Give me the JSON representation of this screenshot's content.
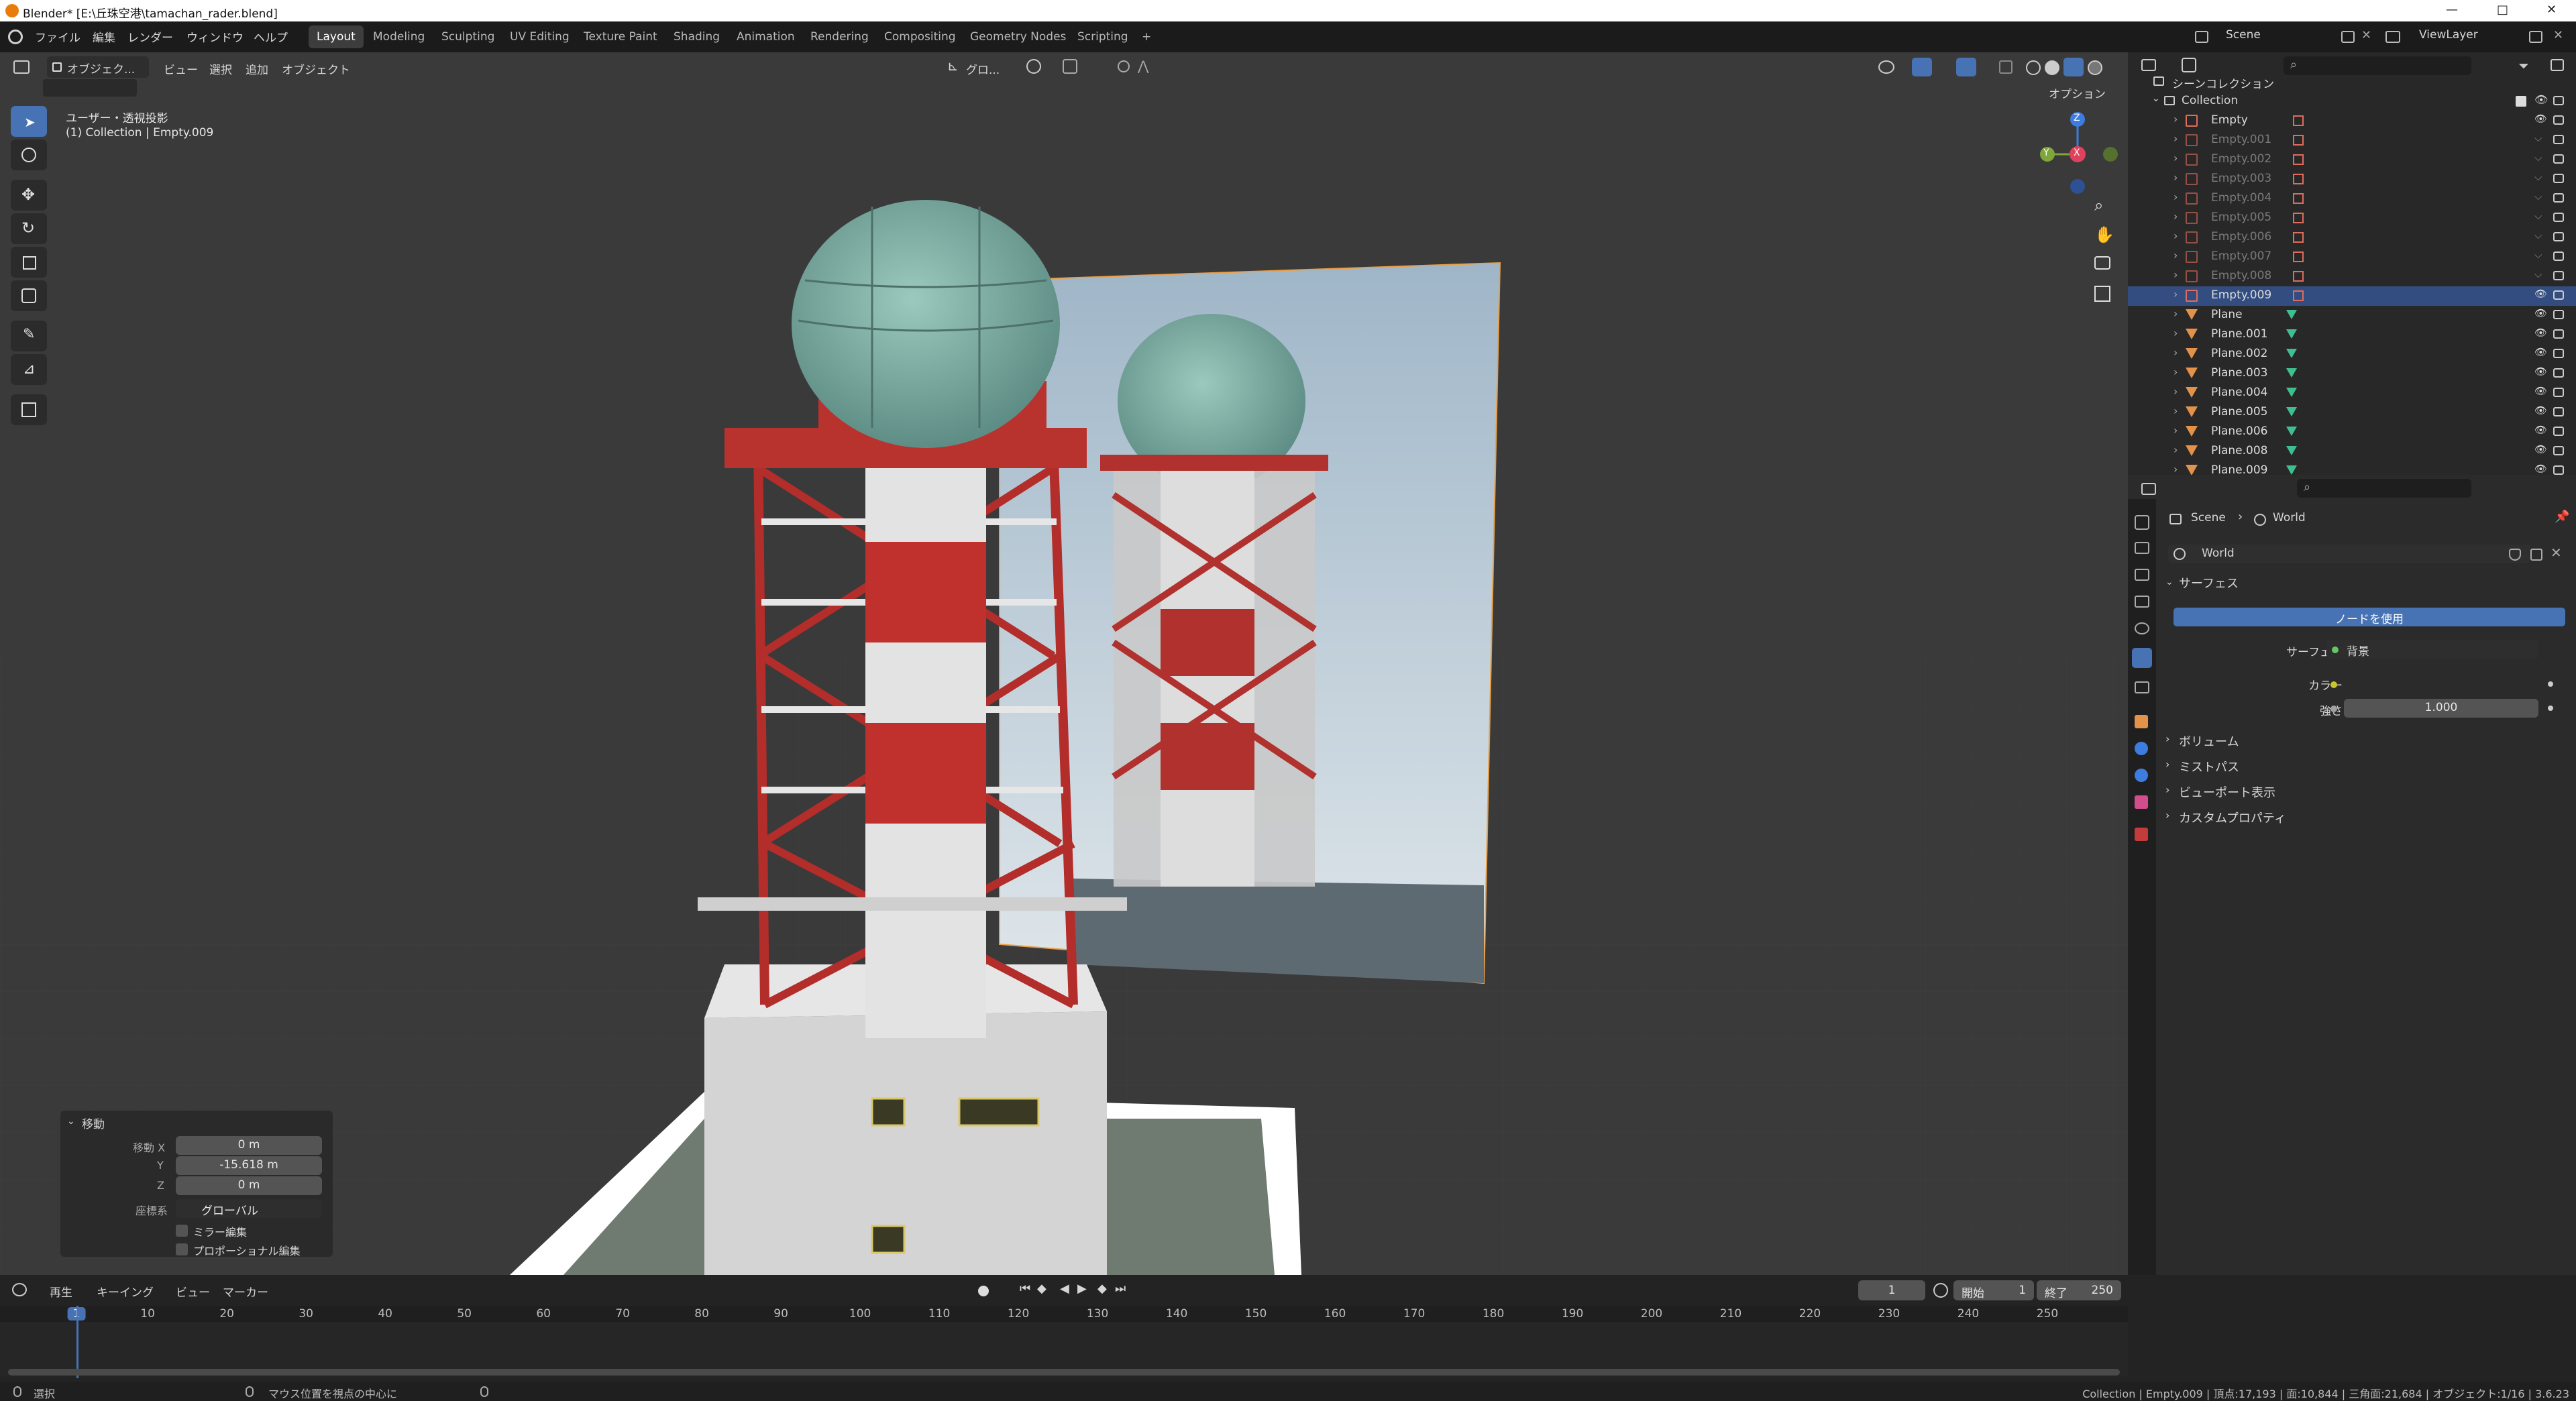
{
  "window": {
    "title": "Blender* [E:\\丘珠空港\\tamachan_rader.blend]",
    "minimize": "—",
    "maximize": "□",
    "close": "✕"
  },
  "menu": {
    "items": [
      "ファイル",
      "編集",
      "レンダー",
      "ウィンドウ",
      "ヘルプ"
    ]
  },
  "workspaces": {
    "tabs": [
      "Layout",
      "Modeling",
      "Sculpting",
      "UV Editing",
      "Texture Paint",
      "Shading",
      "Animation",
      "Rendering",
      "Compositing",
      "Geometry Nodes",
      "Scripting"
    ],
    "active": "Layout",
    "add": "+"
  },
  "topright": {
    "scene": "Scene",
    "viewlayer": "ViewLayer"
  },
  "viewport": {
    "mode": "オブジェク...",
    "menu": [
      "ビュー",
      "選択",
      "追加",
      "オブジェクト"
    ],
    "transform_orientation": "グロ...",
    "options": "オプション",
    "view_name": "ユーザー・透視投影",
    "context": "(1) Collection | Empty.009",
    "axis_x": "X",
    "axis_y": "Y",
    "axis_z": "Z"
  },
  "redo_panel": {
    "title": "移動",
    "move_x_label": "移動 X",
    "move_x": "0 m",
    "y_label": "Y",
    "y": "-15.618 m",
    "z_label": "Z",
    "z": "0 m",
    "orientation_label": "座標系",
    "orientation": "グローバル",
    "mirror": "ミラー編集",
    "proportional": "プロポーショナル編集"
  },
  "outliner": {
    "scene_collection": "シーンコレクション",
    "collection": "Collection",
    "objects": [
      {
        "name": "Empty",
        "type": "empty",
        "dim": false
      },
      {
        "name": "Empty.001",
        "type": "empty",
        "dim": true
      },
      {
        "name": "Empty.002",
        "type": "empty",
        "dim": true
      },
      {
        "name": "Empty.003",
        "type": "empty",
        "dim": true
      },
      {
        "name": "Empty.004",
        "type": "empty",
        "dim": true
      },
      {
        "name": "Empty.005",
        "type": "empty",
        "dim": true
      },
      {
        "name": "Empty.006",
        "type": "empty",
        "dim": true
      },
      {
        "name": "Empty.007",
        "type": "empty",
        "dim": true
      },
      {
        "name": "Empty.008",
        "type": "empty",
        "dim": true
      },
      {
        "name": "Empty.009",
        "type": "empty",
        "dim": false,
        "selected": true
      },
      {
        "name": "Plane",
        "type": "mesh",
        "dim": false
      },
      {
        "name": "Plane.001",
        "type": "mesh",
        "dim": false
      },
      {
        "name": "Plane.002",
        "type": "mesh",
        "dim": false
      },
      {
        "name": "Plane.003",
        "type": "mesh",
        "dim": false
      },
      {
        "name": "Plane.004",
        "type": "mesh",
        "dim": false
      },
      {
        "name": "Plane.005",
        "type": "mesh",
        "dim": false
      },
      {
        "name": "Plane.006",
        "type": "mesh",
        "dim": false
      },
      {
        "name": "Plane.008",
        "type": "mesh",
        "dim": false
      },
      {
        "name": "Plane.009",
        "type": "mesh",
        "dim": false
      }
    ]
  },
  "properties": {
    "breadcrumb_scene": "Scene",
    "breadcrumb_world": "World",
    "world_name": "World",
    "surface_header": "サーフェス",
    "use_nodes": "ノードを使用",
    "surface_label": "サーフェス",
    "surface_value": "背景",
    "color_label": "カラー",
    "strength_label": "強さ",
    "strength_value": "1.000",
    "sections": [
      "ボリューム",
      "ミストパス",
      "ビューポート表示",
      "カスタムプロパティ"
    ]
  },
  "timeline": {
    "menu": [
      "再生",
      "キーイング",
      "ビュー",
      "マーカー"
    ],
    "current_frame": "1",
    "start_label": "開始",
    "start": "1",
    "end_label": "終了",
    "end": "250",
    "ticks": [
      "1",
      "10",
      "20",
      "30",
      "40",
      "50",
      "60",
      "70",
      "80",
      "90",
      "100",
      "110",
      "120",
      "130",
      "140",
      "150",
      "160",
      "170",
      "180",
      "190",
      "200",
      "210",
      "220",
      "230",
      "240",
      "250"
    ]
  },
  "statusbar": {
    "select": "選択",
    "center_view": "マウス位置を視点の中心に",
    "stats": "Collection | Empty.009 | 頂点:17,193 | 面:10,844 | 三角面:21,684 | オブジェクト:1/16 | 3.6.23"
  },
  "colors": {
    "accent": "#4772b3",
    "selected_row": "#334d80",
    "empty_icon": "#e06c5c",
    "mesh_icon": "#e3924a",
    "modifier_icon": "#3fbf8f",
    "axis_x": "#e0415c",
    "axis_y": "#7ea63b",
    "axis_z": "#3d7ce0"
  }
}
